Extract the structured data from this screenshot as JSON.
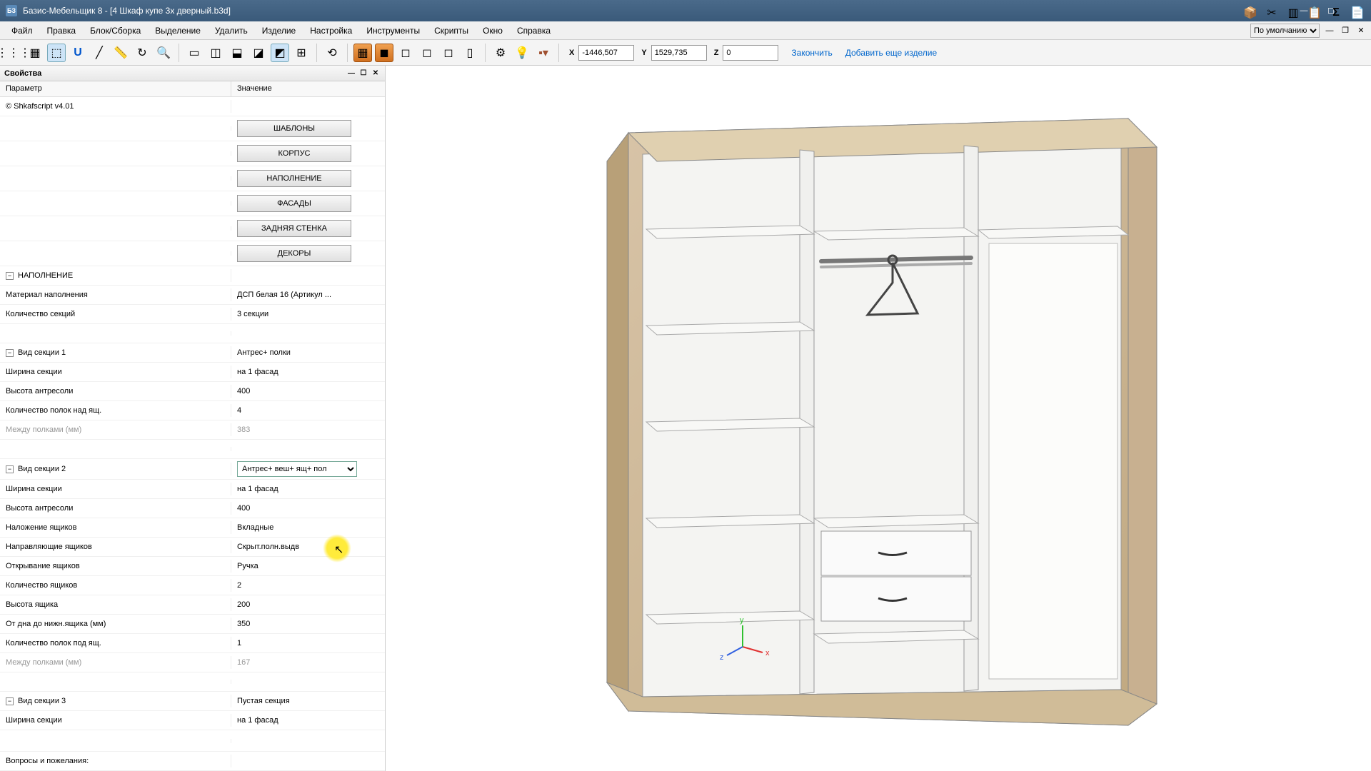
{
  "window": {
    "app_icon": "БЗ",
    "title": "Базис-Мебельщик 8 - [4 Шкаф купе 3х дверный.b3d]"
  },
  "menu": {
    "items": [
      "Файл",
      "Правка",
      "Блок/Сборка",
      "Выделение",
      "Удалить",
      "Изделие",
      "Настройка",
      "Инструменты",
      "Скрипты",
      "Окно",
      "Справка"
    ],
    "preset": "По умолчанию"
  },
  "coords": {
    "x_label": "X",
    "x": "-1446,507",
    "y_label": "Y",
    "y": "1529,735",
    "z_label": "Z",
    "z": "0"
  },
  "actions": {
    "finish": "Закончить",
    "add_more": "Добавить еще изделие"
  },
  "panel": {
    "title": "Свойства",
    "col_param": "Параметр",
    "col_value": "Значение"
  },
  "props": {
    "script_header": "© Shkafscript v4.01",
    "buttons": [
      "ШАБЛОНЫ",
      "КОРПУС",
      "НАПОЛНЕНИЕ",
      "ФАСАДЫ",
      "ЗАДНЯЯ СТЕНКА",
      "ДЕКОРЫ"
    ],
    "fill_section": "НАПОЛНЕНИЕ",
    "fill_material_label": "Материал наполнения",
    "fill_material_value": "ДСП белая 16 (Артикул ...",
    "sections_count_label": "Количество секций",
    "sections_count_value": "3 секции",
    "sec1_label": "Вид секции 1",
    "sec1_value": "Антрес+ полки",
    "sec1_width_label": "Ширина секции",
    "sec1_width_value": "на 1 фасад",
    "sec1_antres_label": "Высота антресоли",
    "sec1_antres_value": "400",
    "sec1_shelves_label": "Количество полок над ящ.",
    "sec1_shelves_value": "4",
    "sec1_gap_label": "Между полками (мм)",
    "sec1_gap_value": "383",
    "sec2_label": "Вид секции 2",
    "sec2_value": "Антрес+ веш+ ящ+ пол",
    "sec2_width_label": "Ширина секции",
    "sec2_width_value": "на 1 фасад",
    "sec2_antres_label": "Высота антресоли",
    "sec2_antres_value": "400",
    "sec2_overlay_label": "Наложение ящиков",
    "sec2_overlay_value": "Вкладные",
    "sec2_guides_label": "Направляющие ящиков",
    "sec2_guides_value": "Скрыт.полн.выдв",
    "sec2_open_label": "Открывание ящиков",
    "sec2_open_value": "Ручка",
    "sec2_drawers_label": "Количество ящиков",
    "sec2_drawers_value": "2",
    "sec2_dheight_label": "Высота ящика",
    "sec2_dheight_value": "200",
    "sec2_bottom_label": "От дна до нижн.ящика (мм)",
    "sec2_bottom_value": "350",
    "sec2_under_label": "Количество полок под ящ.",
    "sec2_under_value": "1",
    "sec2_gap_label": "Между полками (мм)",
    "sec2_gap_value": "167",
    "sec3_label": "Вид секции 3",
    "sec3_value": "Пустая секция",
    "sec3_width_label": "Ширина секции",
    "sec3_width_value": "на 1 фасад",
    "footer": "Вопросы и пожелания:"
  }
}
